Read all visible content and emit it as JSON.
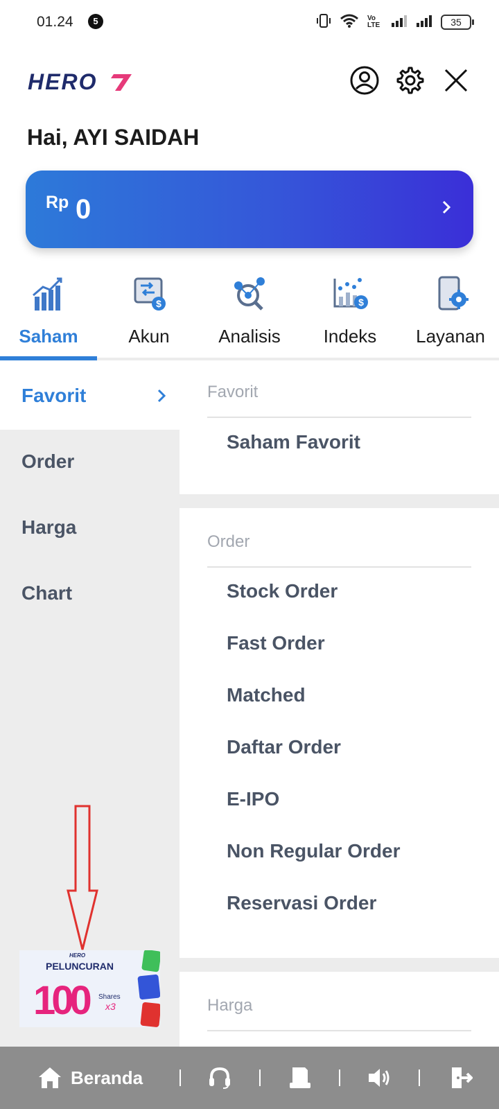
{
  "status_bar": {
    "time": "01.24",
    "notification_count": "5",
    "network_label": "Vo LTE",
    "battery": "35"
  },
  "header": {
    "logo_text": "HERO",
    "icons": [
      "user-icon",
      "gear-icon",
      "close-icon"
    ]
  },
  "greeting": "Hai, AYI SAIDAH",
  "balance": {
    "currency": "Rp",
    "value": "0"
  },
  "tabs": [
    {
      "label": "Saham",
      "icon": "stock-chart-icon",
      "active": true
    },
    {
      "label": "Akun",
      "icon": "account-transfer-icon",
      "active": false
    },
    {
      "label": "Analisis",
      "icon": "analysis-icon",
      "active": false
    },
    {
      "label": "Indeks",
      "icon": "index-chart-icon",
      "active": false
    },
    {
      "label": "Layanan",
      "icon": "service-icon",
      "active": false
    }
  ],
  "left_menu": [
    {
      "label": "Favorit",
      "active": true
    },
    {
      "label": "Order",
      "active": false
    },
    {
      "label": "Harga",
      "active": false
    },
    {
      "label": "Chart",
      "active": false
    }
  ],
  "sections": {
    "favorit": {
      "title": "Favorit",
      "items": [
        "Saham Favorit"
      ]
    },
    "order": {
      "title": "Order",
      "items": [
        "Stock Order",
        "Fast Order",
        "Matched",
        "Daftar Order",
        "E-IPO",
        "Non Regular Order",
        "Reservasi Order"
      ]
    },
    "harga": {
      "title": "Harga"
    }
  },
  "promo": {
    "brand": "HERO",
    "title": "PELUNCURAN",
    "number": "100",
    "shares": "Shares",
    "multiplier": "x3"
  },
  "bottom_nav": {
    "home_label": "Beranda",
    "icons": [
      "home-icon",
      "headset-icon",
      "document-icon",
      "speaker-icon",
      "logout-icon"
    ]
  },
  "colors": {
    "accent": "#2f7fd8",
    "card_gradient_start": "#2d7ad9",
    "card_gradient_end": "#3a2fd8",
    "menu_text": "#4a5465",
    "bottom_nav": "#8d8d8d",
    "annotation": "#e0322f"
  }
}
